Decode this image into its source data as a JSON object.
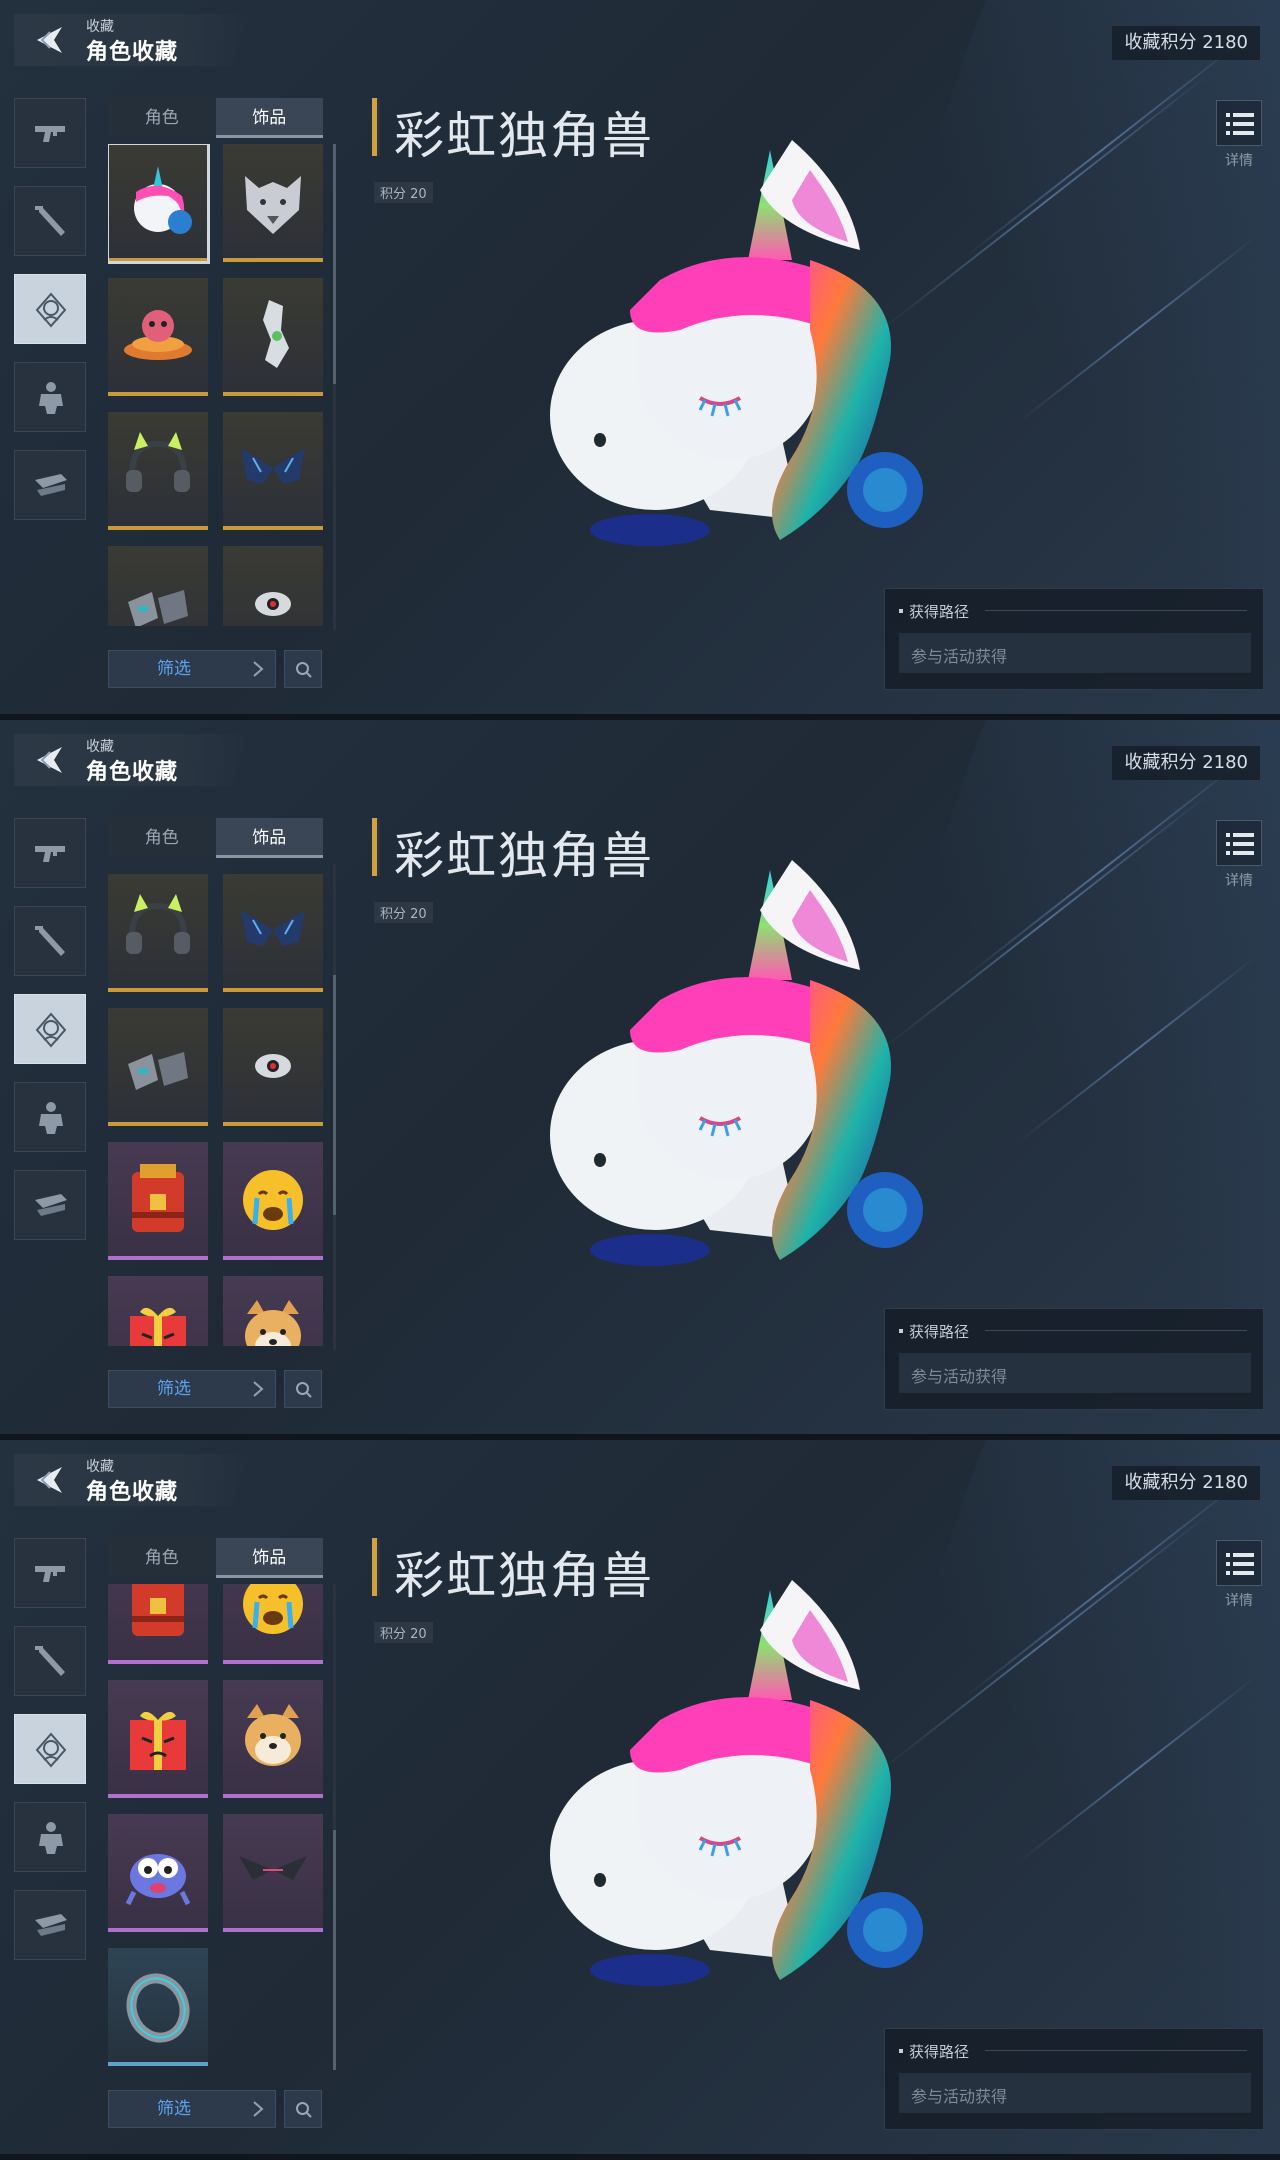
{
  "header": {
    "subtitle": "收藏",
    "title": "角色收藏",
    "score_label": "收藏积分 2180"
  },
  "rail": {
    "items": [
      {
        "icon": "gun-icon"
      },
      {
        "icon": "melee-icon"
      },
      {
        "icon": "head-accessory-icon",
        "selected": true
      },
      {
        "icon": "armor-icon"
      },
      {
        "icon": "vehicle-icon"
      }
    ]
  },
  "tabs": [
    {
      "label": "角色",
      "active": false
    },
    {
      "label": "饰品",
      "active": true
    }
  ],
  "grid": {
    "items": [
      {
        "name": "unicorn-head",
        "rarity": "gold",
        "selected": true
      },
      {
        "name": "wolf-mask",
        "rarity": "gold"
      },
      {
        "name": "ufo-octopus",
        "rarity": "gold"
      },
      {
        "name": "robot-arm",
        "rarity": "gold"
      },
      {
        "name": "cat-ear-headphones",
        "rarity": "gold"
      },
      {
        "name": "crystal-wings",
        "rarity": "gold"
      },
      {
        "name": "metal-gloves",
        "rarity": "gold"
      },
      {
        "name": "red-eye-drone",
        "rarity": "gold"
      },
      {
        "name": "treasure-backpack",
        "rarity": "purple"
      },
      {
        "name": "crying-emoji",
        "rarity": "purple"
      },
      {
        "name": "angry-gift-box",
        "rarity": "purple"
      },
      {
        "name": "shiba-head",
        "rarity": "purple"
      },
      {
        "name": "scared-blob",
        "rarity": "purple"
      },
      {
        "name": "dark-wings",
        "rarity": "purple"
      },
      {
        "name": "metal-ring",
        "rarity": "blue"
      }
    ]
  },
  "filter": {
    "label": "筛选"
  },
  "item": {
    "title": "彩虹独角兽",
    "points": "积分 20"
  },
  "detail": {
    "label": "详情"
  },
  "acquire": {
    "title": "获得路径",
    "value": "参与活动获得"
  },
  "screens": [
    {
      "scroll_fraction": 0.0
    },
    {
      "scroll_fraction": 0.45
    },
    {
      "scroll_fraction": 1.0
    }
  ],
  "colors": {
    "gold_rarity": "#c89a3c",
    "purple_rarity": "#b070d0",
    "blue_rarity": "#5fa3c8",
    "filter_text": "#5fa2ee",
    "title_bar": "#d2a23e"
  }
}
